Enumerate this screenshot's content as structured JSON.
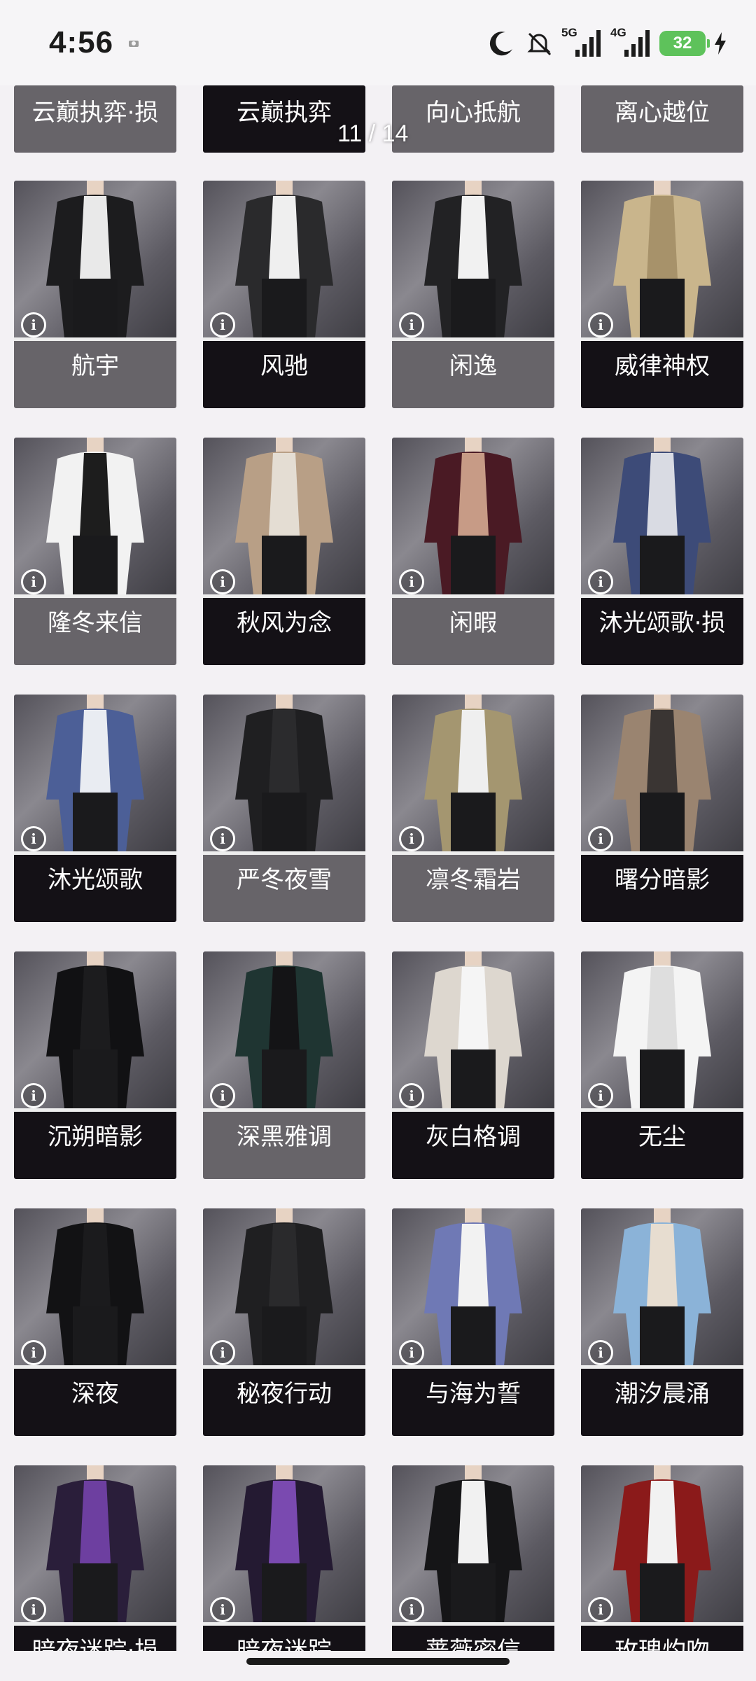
{
  "status": {
    "time": "4:56",
    "net1": "5G",
    "net2": "4G",
    "battery": "32"
  },
  "viewer": {
    "page_indicator": "11 / 14"
  },
  "top_row": [
    "云巅执弈·损",
    "云巅执弈",
    "向心抵航",
    "离心越位"
  ],
  "rows": [
    [
      {
        "name": "航宇",
        "style": "gray",
        "outfit": "#1c1c1e",
        "shirt": "#e9e9e9"
      },
      {
        "name": "风驰",
        "style": "dark",
        "outfit": "#2a2a2c",
        "shirt": "#efefef"
      },
      {
        "name": "闲逸",
        "style": "gray",
        "outfit": "#222224",
        "shirt": "#f1f1f1"
      },
      {
        "name": "威律神权",
        "style": "dark",
        "outfit": "#c9b58c",
        "shirt": "#a7926a"
      }
    ],
    [
      {
        "name": "隆冬来信",
        "style": "gray",
        "outfit": "#f2f2f2",
        "shirt": "#1d1d1d"
      },
      {
        "name": "秋风为念",
        "style": "dark",
        "outfit": "#b89f86",
        "shirt": "#e4ddd3"
      },
      {
        "name": "闲暇",
        "style": "gray",
        "outfit": "#4a1a24",
        "shirt": "#c79b86"
      },
      {
        "name": "沐光颂歌·损",
        "style": "dark",
        "outfit": "#3d4b78",
        "shirt": "#d9dbe3"
      }
    ],
    [
      {
        "name": "沐光颂歌",
        "style": "dark",
        "outfit": "#4c5f97",
        "shirt": "#e9ecf2"
      },
      {
        "name": "严冬夜雪",
        "style": "gray",
        "outfit": "#1f1f21",
        "shirt": "#2b2b2d"
      },
      {
        "name": "凛冬霜岩",
        "style": "gray",
        "outfit": "#a49670",
        "shirt": "#efefef"
      },
      {
        "name": "曙分暗影",
        "style": "dark",
        "outfit": "#9a8470",
        "shirt": "#3a3533"
      }
    ],
    [
      {
        "name": "沉朔暗影",
        "style": "dark",
        "outfit": "#111113",
        "shirt": "#1c1c1e"
      },
      {
        "name": "深黑雅调",
        "style": "gray",
        "outfit": "#1f3532",
        "shirt": "#141416"
      },
      {
        "name": "灰白格调",
        "style": "dark",
        "outfit": "#ddd7cf",
        "shirt": "#f5f5f5"
      },
      {
        "name": "无尘",
        "style": "dark",
        "outfit": "#f4f4f4",
        "shirt": "#dedede"
      }
    ],
    [
      {
        "name": "深夜",
        "style": "dark",
        "outfit": "#121214",
        "shirt": "#1b1b1d"
      },
      {
        "name": "秘夜行动",
        "style": "dark",
        "outfit": "#1f1f21",
        "shirt": "#2a2a2c"
      },
      {
        "name": "与海为誓",
        "style": "dark",
        "outfit": "#6f79b5",
        "shirt": "#f2f2f2"
      },
      {
        "name": "潮汐晨涌",
        "style": "dark",
        "outfit": "#8bb3d8",
        "shirt": "#e7ddd0"
      }
    ],
    [
      {
        "name": "暗夜迷踪·损",
        "style": "dark",
        "outfit": "#2a1e3a",
        "shirt": "#6d3fa0"
      },
      {
        "name": "暗夜迷踪",
        "style": "dark",
        "outfit": "#241a32",
        "shirt": "#7a4ab0"
      },
      {
        "name": "蔷薇密信",
        "style": "dark",
        "outfit": "#151517",
        "shirt": "#f1f1f1"
      },
      {
        "name": "玫瑰灼吻",
        "style": "dark",
        "outfit": "#8b1a1a",
        "shirt": "#f2f2f2"
      }
    ]
  ]
}
